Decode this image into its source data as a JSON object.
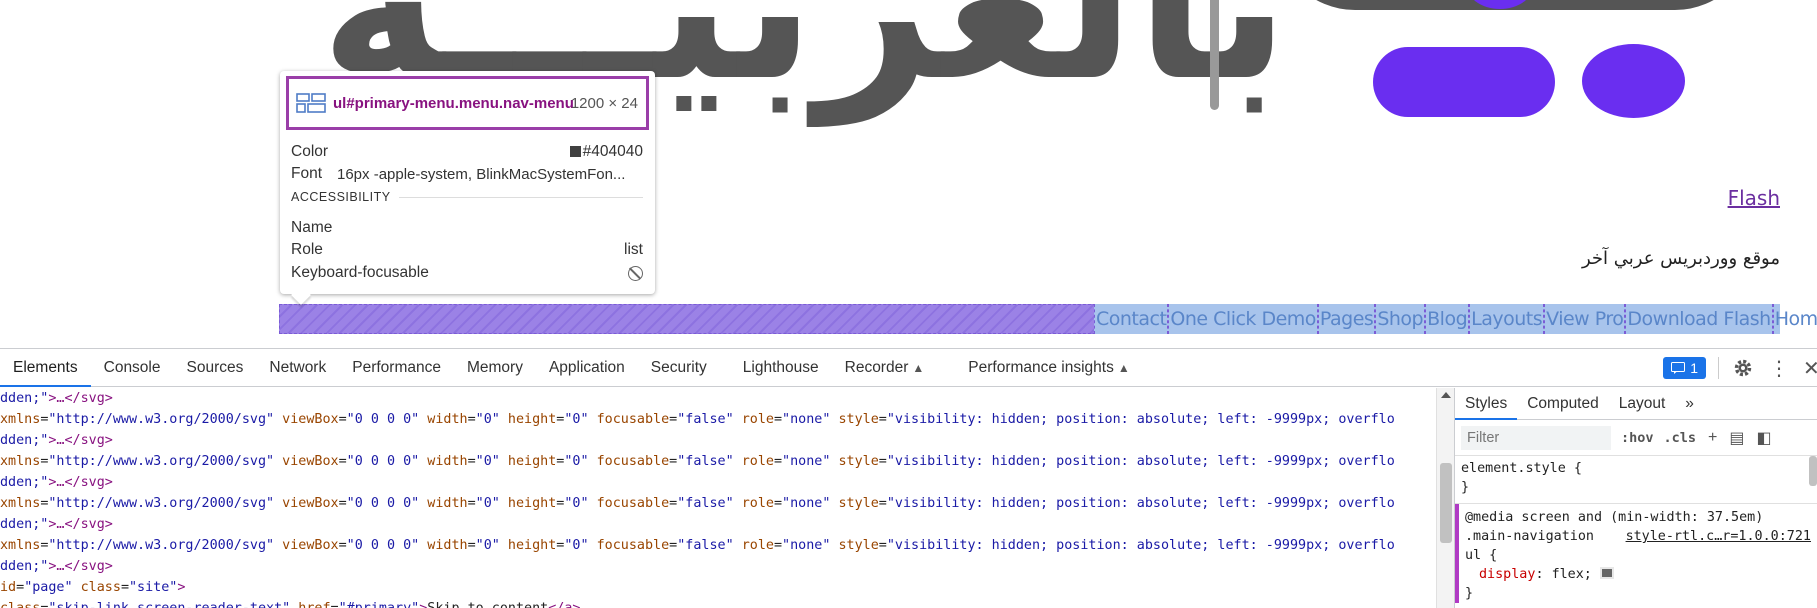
{
  "page": {
    "logo_text": "بالعربيـــة",
    "flash_link": "Flash",
    "tagline": "موقع ووردبريس عربي آخر",
    "nav": {
      "items": [
        "Contact",
        "One Click Demo",
        "Pages",
        "Shop",
        "Blog",
        "Layouts",
        "View Pro",
        "Download Flash",
        "Home"
      ]
    }
  },
  "tooltip": {
    "selector": "ul#primary-menu.menu.nav-menu",
    "size": "1200 × 24",
    "color_label": "Color",
    "color_value": "#404040",
    "font_label": "Font",
    "font_value": "16px -apple-system, BlinkMacSystemFon...",
    "accessibility_title": "ACCESSIBILITY",
    "name_label": "Name",
    "role_label": "Role",
    "role_value": "list",
    "keyboard_label": "Keyboard-focusable",
    "colors": {
      "border": "#9a3ea8",
      "selector": "#881280",
      "swatch": "#404040"
    }
  },
  "devtools": {
    "tabs": [
      "Elements",
      "Console",
      "Sources",
      "Network",
      "Performance",
      "Memory",
      "Application",
      "Security",
      "Lighthouse",
      "Recorder",
      "Performance insights"
    ],
    "active_tab": "Elements",
    "issues_count": "1",
    "code_lines": [
      [
        "dden;\">…</svg>"
      ],
      [
        "xmlns=\"http://www.w3.org/2000/svg\" viewBox=\"0 0 0 0\" width=\"0\" height=\"0\" focusable=\"false\" role=\"none\" style=\"visibility: hidden; position: absolute; left: -9999px; overflo"
      ],
      [
        "dden;\">…</svg>"
      ],
      [
        "xmlns=\"http://www.w3.org/2000/svg\" viewBox=\"0 0 0 0\" width=\"0\" height=\"0\" focusable=\"false\" role=\"none\" style=\"visibility: hidden; position: absolute; left: -9999px; overflo"
      ],
      [
        "dden;\">…</svg>"
      ],
      [
        "xmlns=\"http://www.w3.org/2000/svg\" viewBox=\"0 0 0 0\" width=\"0\" height=\"0\" focusable=\"false\" role=\"none\" style=\"visibility: hidden; position: absolute; left: -9999px; overflo"
      ],
      [
        "dden;\">…</svg>"
      ],
      [
        "xmlns=\"http://www.w3.org/2000/svg\" viewBox=\"0 0 0 0\" width=\"0\" height=\"0\" focusable=\"false\" role=\"none\" style=\"visibility: hidden; position: absolute; left: -9999px; overflo"
      ],
      [
        "dden;\">…</svg>"
      ],
      [
        "id=\"page\" class=\"site\">"
      ],
      [
        "class=\"skip-link screen-reader-text\" href=\"#primary\">Skip to content</a>"
      ]
    ],
    "styles": {
      "tabs": [
        "Styles",
        "Computed",
        "Layout",
        "»"
      ],
      "active_tab": "Styles",
      "filter_placeholder": "Filter",
      "hov": ":hov",
      "cls": ".cls",
      "element_style": "element.style {",
      "close_brace": "}",
      "media": "@media screen and (min-width: 37.5em)",
      "selector_line1": ".main-navigation",
      "selector_line2": "ul {",
      "source": "style-rtl.c…r=1.0.0:721",
      "property": "display",
      "value": "flex;"
    }
  }
}
